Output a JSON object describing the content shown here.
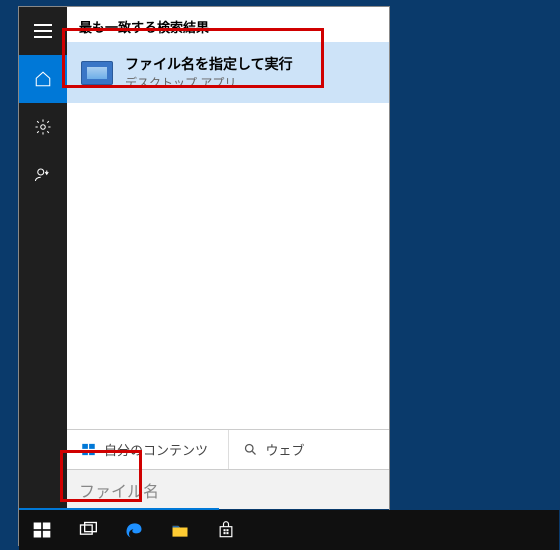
{
  "header": {
    "label": "最も一致する検索結果"
  },
  "result": {
    "title": "ファイル名を指定して実行",
    "subtitle": "デスクトップ アプリ"
  },
  "tabs": {
    "local": "自分のコンテンツ",
    "web": "ウェブ"
  },
  "search": {
    "value": "ファイル名"
  },
  "sidebar": {
    "menu": "menu",
    "home": "home",
    "settings": "settings",
    "feedback": "feedback"
  }
}
